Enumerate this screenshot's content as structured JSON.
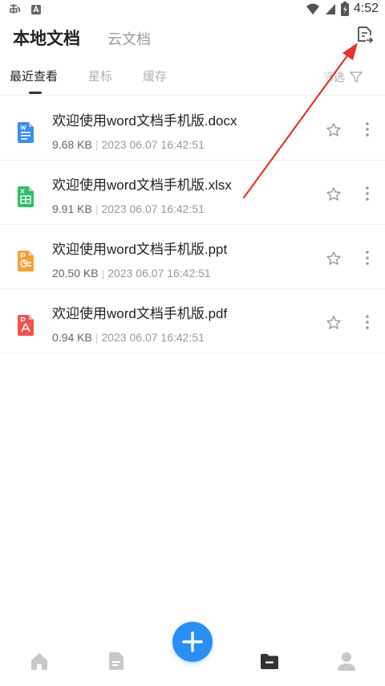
{
  "status_bar": {
    "time": "4:52"
  },
  "header": {
    "tabs": [
      {
        "label": "本地文档",
        "active": true
      },
      {
        "label": "云文档",
        "active": false
      }
    ],
    "action_icon": "document-transfer-icon"
  },
  "sub_tabs": {
    "items": [
      "最近查看",
      "星标",
      "缓存"
    ],
    "active": "最近查看",
    "filter_label": "筛选"
  },
  "files": [
    {
      "name": "欢迎使用word文档手机版.docx",
      "size": "9.68 KB",
      "date": "2023 06.07 16:42:51",
      "icon": "word-file-icon",
      "color": "#3b8df5"
    },
    {
      "name": "欢迎使用word文档手机版.xlsx",
      "size": "9.91 KB",
      "date": "2023 06.07 16:42:51",
      "icon": "excel-file-icon",
      "color": "#2fbf6b"
    },
    {
      "name": "欢迎使用word文档手机版.ppt",
      "size": "20.50 KB",
      "date": "2023 06.07 16:42:51",
      "icon": "ppt-file-icon",
      "color": "#f5a13b"
    },
    {
      "name": "欢迎使用word文档手机版.pdf",
      "size": "0.94 KB",
      "date": "2023 06.07 16:42:51",
      "icon": "pdf-file-icon",
      "color": "#ef5350"
    }
  ],
  "bottom_nav": {
    "items": [
      "home-icon",
      "document-icon",
      "add-icon",
      "folder-icon",
      "profile-icon"
    ],
    "fab_color": "#2b8ef5"
  },
  "annotation": {
    "type": "arrow",
    "color": "#e8322a"
  }
}
